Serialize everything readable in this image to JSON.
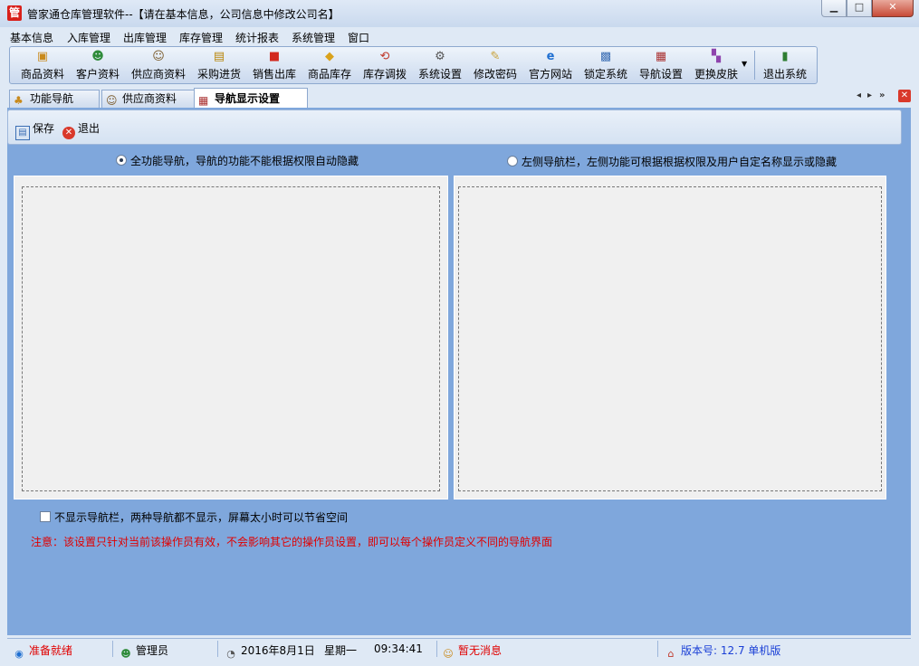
{
  "window": {
    "icon_glyph": "管",
    "title": "管家通仓库管理软件--【请在基本信息，公司信息中修改公司名】",
    "min_glyph": "▁",
    "max_glyph": "□",
    "close_glyph": "✕"
  },
  "menu": [
    "基本信息",
    "入库管理",
    "出库管理",
    "库存管理",
    "统计报表",
    "系统管理",
    "窗口"
  ],
  "toolbar": {
    "items": [
      {
        "label": "商品资料",
        "icon": "box-icon"
      },
      {
        "label": "客户资料",
        "icon": "people-icon"
      },
      {
        "label": "供应商资料",
        "icon": "supplier-icon"
      },
      {
        "label": "采购进货",
        "icon": "truck-icon"
      },
      {
        "label": "销售出库",
        "icon": "basket-icon"
      },
      {
        "label": "商品库存",
        "icon": "warehouse-icon"
      },
      {
        "label": "库存调拨",
        "icon": "transfer-icon"
      },
      {
        "label": "系统设置",
        "icon": "settings-icon"
      },
      {
        "label": "修改密码",
        "icon": "key-icon"
      },
      {
        "label": "官方网站",
        "icon": "ie-icon"
      },
      {
        "label": "锁定系统",
        "icon": "lock-icon"
      },
      {
        "label": "导航设置",
        "icon": "nav-icon"
      },
      {
        "label": "更换皮肤",
        "icon": "skin-icon"
      },
      {
        "label": "退出系统",
        "icon": "exit-icon"
      }
    ]
  },
  "tabs": [
    {
      "label": "功能导航",
      "active": false
    },
    {
      "label": "供应商资料",
      "active": false
    },
    {
      "label": "导航显示设置",
      "active": true
    }
  ],
  "commands": {
    "save": "保存",
    "exit": "退出"
  },
  "options": {
    "full_nav": "全功能导航，导航的功能不能根据权限自动隐藏",
    "left_nav": "左侧导航栏，左侧功能可根据根据权限及用户自定名称显示或隐藏",
    "full_nav_selected": true,
    "left_nav_selected": false,
    "hide_nav": "不显示导航栏，两种导航都不显示，屏幕太小时可以节省空间",
    "hide_nav_checked": false,
    "note": "注意：该设置只针对当前该操作员有效，不会影响其它的操作员设置，即可以每个操作员定义不同的导航界面"
  },
  "status": {
    "ready": "准备就绪",
    "user": "管理员",
    "date": "2016年8月1日",
    "weekday": "星期一",
    "time": "09:34:41",
    "message": "暂无消息",
    "version": "版本号: 12.7 单机版"
  },
  "colors": {
    "accent": "#7fa7dc",
    "note_red": "#e00000",
    "status_red": "#e00000",
    "version_blue": "#1a3fd6"
  }
}
